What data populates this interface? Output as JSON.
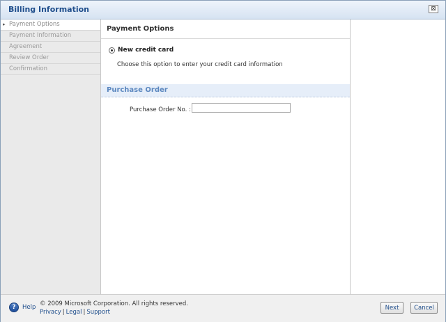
{
  "dialog": {
    "title": "Billing Information",
    "close_glyph": "⊠"
  },
  "sidebar": {
    "items": [
      {
        "label": "Payment Options",
        "active": true
      },
      {
        "label": "Payment Information",
        "active": false
      },
      {
        "label": "Agreement",
        "active": false
      },
      {
        "label": "Review Order",
        "active": false
      },
      {
        "label": "Confirmation",
        "active": false
      }
    ],
    "active_marker": "▸"
  },
  "payment_options": {
    "title": "Payment Options",
    "option_label": "New credit card",
    "option_selected": true,
    "option_description": "Choose this option to enter your credit card information"
  },
  "purchase_order": {
    "title": "Purchase Order",
    "field_label": "Purchase Order No. :",
    "field_value": ""
  },
  "footer": {
    "help_icon": "help-icon",
    "help_glyph": "?",
    "help_label": "Help",
    "copyright": "© 2009 Microsoft Corporation. All rights reserved.",
    "links": [
      "Privacy",
      "Legal",
      "Support"
    ],
    "link_separator": "|"
  },
  "buttons": {
    "next": "Next",
    "cancel": "Cancel"
  }
}
